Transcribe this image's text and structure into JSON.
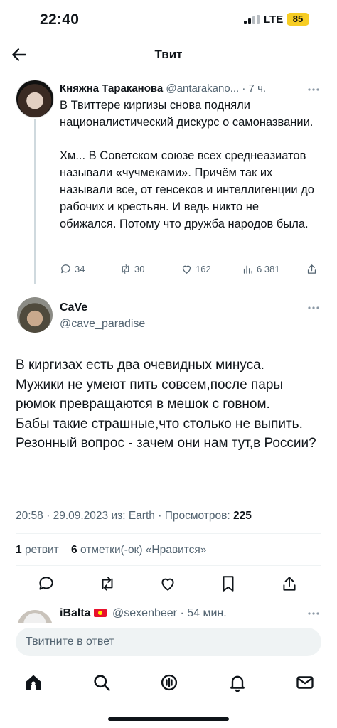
{
  "status_bar": {
    "time": "22:40",
    "network": "LTE",
    "battery": "85"
  },
  "nav": {
    "title": "Твит"
  },
  "parent_tweet": {
    "name": "Княжна Тараканова",
    "handle": "@antarakano...",
    "time": "· 7 ч.",
    "text": "В Твиттере киргизы снова подняли националистический дискурс о самоназвании.\n\nХм... В Советском союзе всех среднеазиатов называли «чучмеками». Причём так их называли все, от генсеков и интеллигенции до рабочих и крестьян. И ведь никто не обижался. Потому что дружба народов была.",
    "replies": "34",
    "retweets": "30",
    "likes": "162",
    "views": "6 381"
  },
  "main_tweet": {
    "name": "CaVe",
    "handle": "@cave_paradise",
    "text": "В киргизах есть два очевидных минуса.\nМужики не умеют пить совсем,после пары рюмок превращаются в мешок с говном.\nБабы такие страшные,что столько не выпить.\nРезонный вопрос - зачем они нам тут,в России?",
    "meta_time": "20:58",
    "meta_date": "29.09.2023",
    "meta_source": "из: Earth",
    "meta_views_label": "Просмотров:",
    "meta_views": "225",
    "retweet_count": "1",
    "retweet_label": "ретвит",
    "like_count": "6",
    "like_label": "отметки(-ок) «Нравится»"
  },
  "reply_preview": {
    "name": "iBalta",
    "handle": "@sexenbeer",
    "time": "· 54 мин."
  },
  "reply_box": {
    "placeholder": "Твитните в ответ"
  },
  "colors": {
    "text": "#0f1419",
    "muted": "#536471",
    "battery": "#f7cd24",
    "divider": "#eff3f4"
  }
}
